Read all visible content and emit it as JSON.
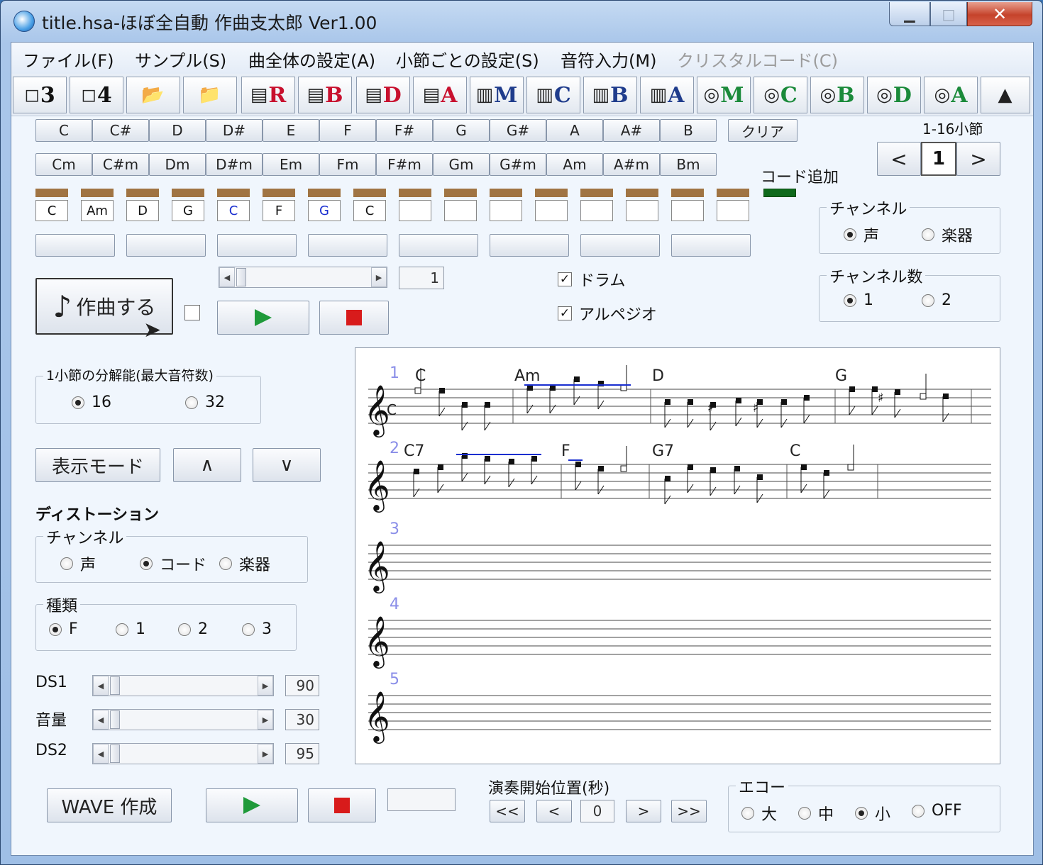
{
  "window": {
    "title": "title.hsa-ほぼ全自動 作曲支太郎 Ver1.00",
    "min": "▁",
    "max": "□",
    "close": "✕"
  },
  "menu": [
    "ファイル(F)",
    "サンプル(S)",
    "曲全体の設定(A)",
    "小節ごとの設定(S)",
    "音符入力(M)",
    "クリスタルコード(C)"
  ],
  "toolbar": [
    {
      "icon": "page-icon",
      "glyph": "◻",
      "label": "3"
    },
    {
      "icon": "page-icon",
      "glyph": "◻",
      "label": "4"
    },
    {
      "icon": "folder-open-icon",
      "glyph": "📂",
      "label": ""
    },
    {
      "icon": "folder-save-icon",
      "glyph": "📁",
      "label": ""
    },
    {
      "icon": "score-icon",
      "glyph": "▤",
      "label": "R",
      "color": "#c8102e"
    },
    {
      "icon": "score-icon",
      "glyph": "▤",
      "label": "B",
      "color": "#c8102e"
    },
    {
      "icon": "score-icon",
      "glyph": "▤",
      "label": "D",
      "color": "#c8102e"
    },
    {
      "icon": "score-icon",
      "glyph": "▤",
      "label": "A",
      "color": "#c8102e"
    },
    {
      "icon": "piano-icon",
      "glyph": "▥",
      "label": "M",
      "color": "#1f3c8c"
    },
    {
      "icon": "piano-icon",
      "glyph": "▥",
      "label": "C",
      "color": "#1f3c8c"
    },
    {
      "icon": "piano-icon",
      "glyph": "▥",
      "label": "B",
      "color": "#1f3c8c"
    },
    {
      "icon": "piano-icon",
      "glyph": "▥",
      "label": "A",
      "color": "#1f3c8c"
    },
    {
      "icon": "speaker-icon",
      "glyph": "◎",
      "label": "M",
      "color": "#1a8a3a"
    },
    {
      "icon": "speaker-icon",
      "glyph": "◎",
      "label": "C",
      "color": "#1a8a3a"
    },
    {
      "icon": "speaker-icon",
      "glyph": "◎",
      "label": "B",
      "color": "#1a8a3a"
    },
    {
      "icon": "speaker-icon",
      "glyph": "◎",
      "label": "D",
      "color": "#1a8a3a"
    },
    {
      "icon": "speaker-icon",
      "glyph": "◎",
      "label": "A",
      "color": "#1a8a3a"
    },
    {
      "icon": "metronome-icon",
      "glyph": "▲",
      "label": ""
    }
  ],
  "chords_major": [
    "C",
    "C#",
    "D",
    "D#",
    "E",
    "F",
    "F#",
    "G",
    "G#",
    "A",
    "A#",
    "B"
  ],
  "chords_minor": [
    "Cm",
    "C#m",
    "Dm",
    "D#m",
    "Em",
    "Fm",
    "F#m",
    "Gm",
    "G#m",
    "Am",
    "A#m",
    "Bm"
  ],
  "clear_label": "クリア",
  "chord_slots": [
    {
      "text": "C",
      "color": "#111"
    },
    {
      "text": "Am",
      "color": "#111"
    },
    {
      "text": "D",
      "color": "#111"
    },
    {
      "text": "G",
      "color": "#111"
    },
    {
      "text": "C",
      "color": "#1a2fd0"
    },
    {
      "text": "F",
      "color": "#111"
    },
    {
      "text": "G",
      "color": "#1a2fd0"
    },
    {
      "text": "C",
      "color": "#111"
    },
    {
      "text": "",
      "color": "#111"
    },
    {
      "text": "",
      "color": "#111"
    },
    {
      "text": "",
      "color": "#111"
    },
    {
      "text": "",
      "color": "#111"
    },
    {
      "text": "",
      "color": "#111"
    },
    {
      "text": "",
      "color": "#111"
    },
    {
      "text": "",
      "color": "#111"
    },
    {
      "text": "",
      "color": "#111"
    }
  ],
  "chord_add_label": "コード追加",
  "measure": {
    "range_label": "1-16小節",
    "prev": "<",
    "value": "1",
    "next": ">"
  },
  "channel": {
    "title": "チャンネル",
    "options": [
      "声",
      "楽器"
    ],
    "selected": 0
  },
  "channel_count": {
    "title": "チャンネル数",
    "options": [
      "1",
      "2"
    ],
    "selected": 0
  },
  "compose_label": "作曲する",
  "scroll_value": "1",
  "checks": {
    "drum": "ドラム",
    "arpeggio": "アルペジオ"
  },
  "resolution": {
    "title": "1小節の分解能(最大音符数)",
    "options": [
      "16",
      "32"
    ],
    "selected": 0
  },
  "display_mode": "表示モード",
  "up": "∧",
  "down": "∨",
  "distortion": {
    "title": "ディストーション"
  },
  "dist_channel": {
    "title": "チャンネル",
    "options": [
      "声",
      "コード",
      "楽器"
    ],
    "selected": 1
  },
  "dist_type": {
    "title": "種類",
    "options": [
      "F",
      "1",
      "2",
      "3"
    ],
    "selected": 0
  },
  "sliders": [
    {
      "label": "DS1",
      "value": "90"
    },
    {
      "label": "音量",
      "value": "30"
    },
    {
      "label": "DS2",
      "value": "95"
    }
  ],
  "wave_label": "WAVE 作成",
  "start_pos": {
    "title": "演奏開始位置(秒)",
    "rew": "<<",
    "prev": "<",
    "value": "0",
    "next": ">",
    "ff": ">>"
  },
  "echo": {
    "title": "エコー",
    "options": [
      "大",
      "中",
      "小",
      "OFF"
    ],
    "selected": 2
  },
  "score": {
    "staff_numbers": [
      "1",
      "2",
      "3",
      "4",
      "5"
    ],
    "row1_chords": [
      "C",
      "Am",
      "D",
      "G"
    ],
    "row2_chords": [
      "C7",
      "F",
      "G7",
      "C"
    ],
    "clef_key": "C"
  }
}
